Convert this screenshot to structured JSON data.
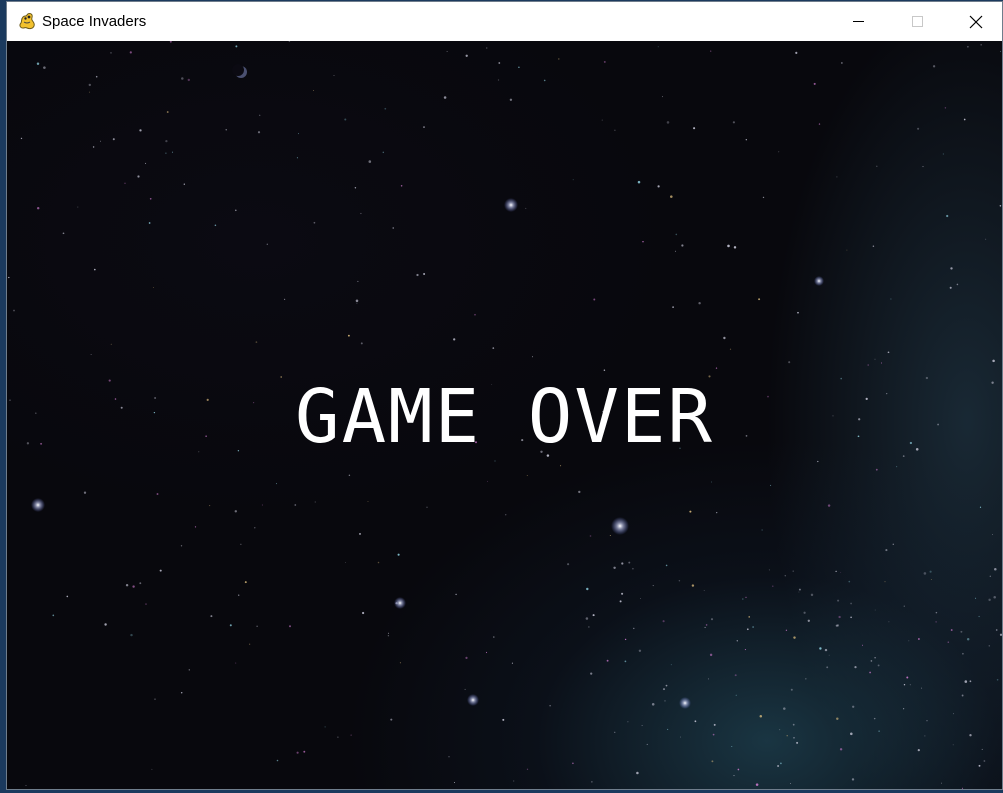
{
  "window": {
    "title": "Space Invaders",
    "icon": "pygame-snake-icon"
  },
  "titlebar_buttons": {
    "minimize": "minimize-icon",
    "maximize": "maximize-icon",
    "close": "close-icon"
  },
  "game": {
    "message": "GAME OVER",
    "background": "starfield",
    "text_color": "#ffffff"
  }
}
